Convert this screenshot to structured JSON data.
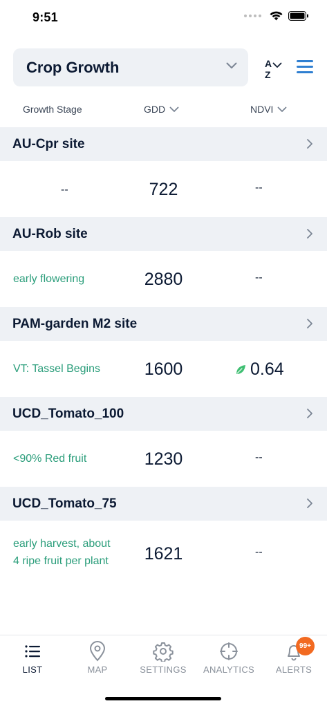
{
  "status": {
    "time": "9:51"
  },
  "header": {
    "title": "Crop Growth",
    "sort_top": "A",
    "sort_bottom": "Z"
  },
  "columns": {
    "stage": "Growth Stage",
    "gdd": "GDD",
    "ndvi": "NDVI"
  },
  "sites": [
    {
      "name": "AU-Cpr site",
      "stage": "--",
      "gdd": "722",
      "ndvi": "--"
    },
    {
      "name": "AU-Rob site",
      "stage": "early flowering",
      "gdd": "2880",
      "ndvi": "--"
    },
    {
      "name": "PAM-garden M2 site",
      "stage": "VT: Tassel Begins",
      "gdd": "1600",
      "ndvi": "0.64"
    },
    {
      "name": "UCD_Tomato_100",
      "stage": "<90% Red fruit",
      "gdd": "1230",
      "ndvi": "--"
    },
    {
      "name": "UCD_Tomato_75",
      "stage_line1": "early harvest, about",
      "stage_line2": "4 ripe fruit per plant",
      "gdd": "1621",
      "ndvi": "--"
    }
  ],
  "tabs": [
    {
      "label": "LIST",
      "icon": "list-icon"
    },
    {
      "label": "MAP",
      "icon": "map-pin-icon"
    },
    {
      "label": "SETTINGS",
      "icon": "gear-icon"
    },
    {
      "label": "ANALYTICS",
      "icon": "crosshair-icon"
    },
    {
      "label": "ALERTS",
      "icon": "bell-icon"
    }
  ],
  "alerts_badge": "99+",
  "colors": {
    "accent": "#2f7fd1",
    "stage_green": "#2a9d7a",
    "leaf_green": "#3fbf72",
    "badge_orange": "#f26a21",
    "header_bg": "#eef1f5"
  }
}
